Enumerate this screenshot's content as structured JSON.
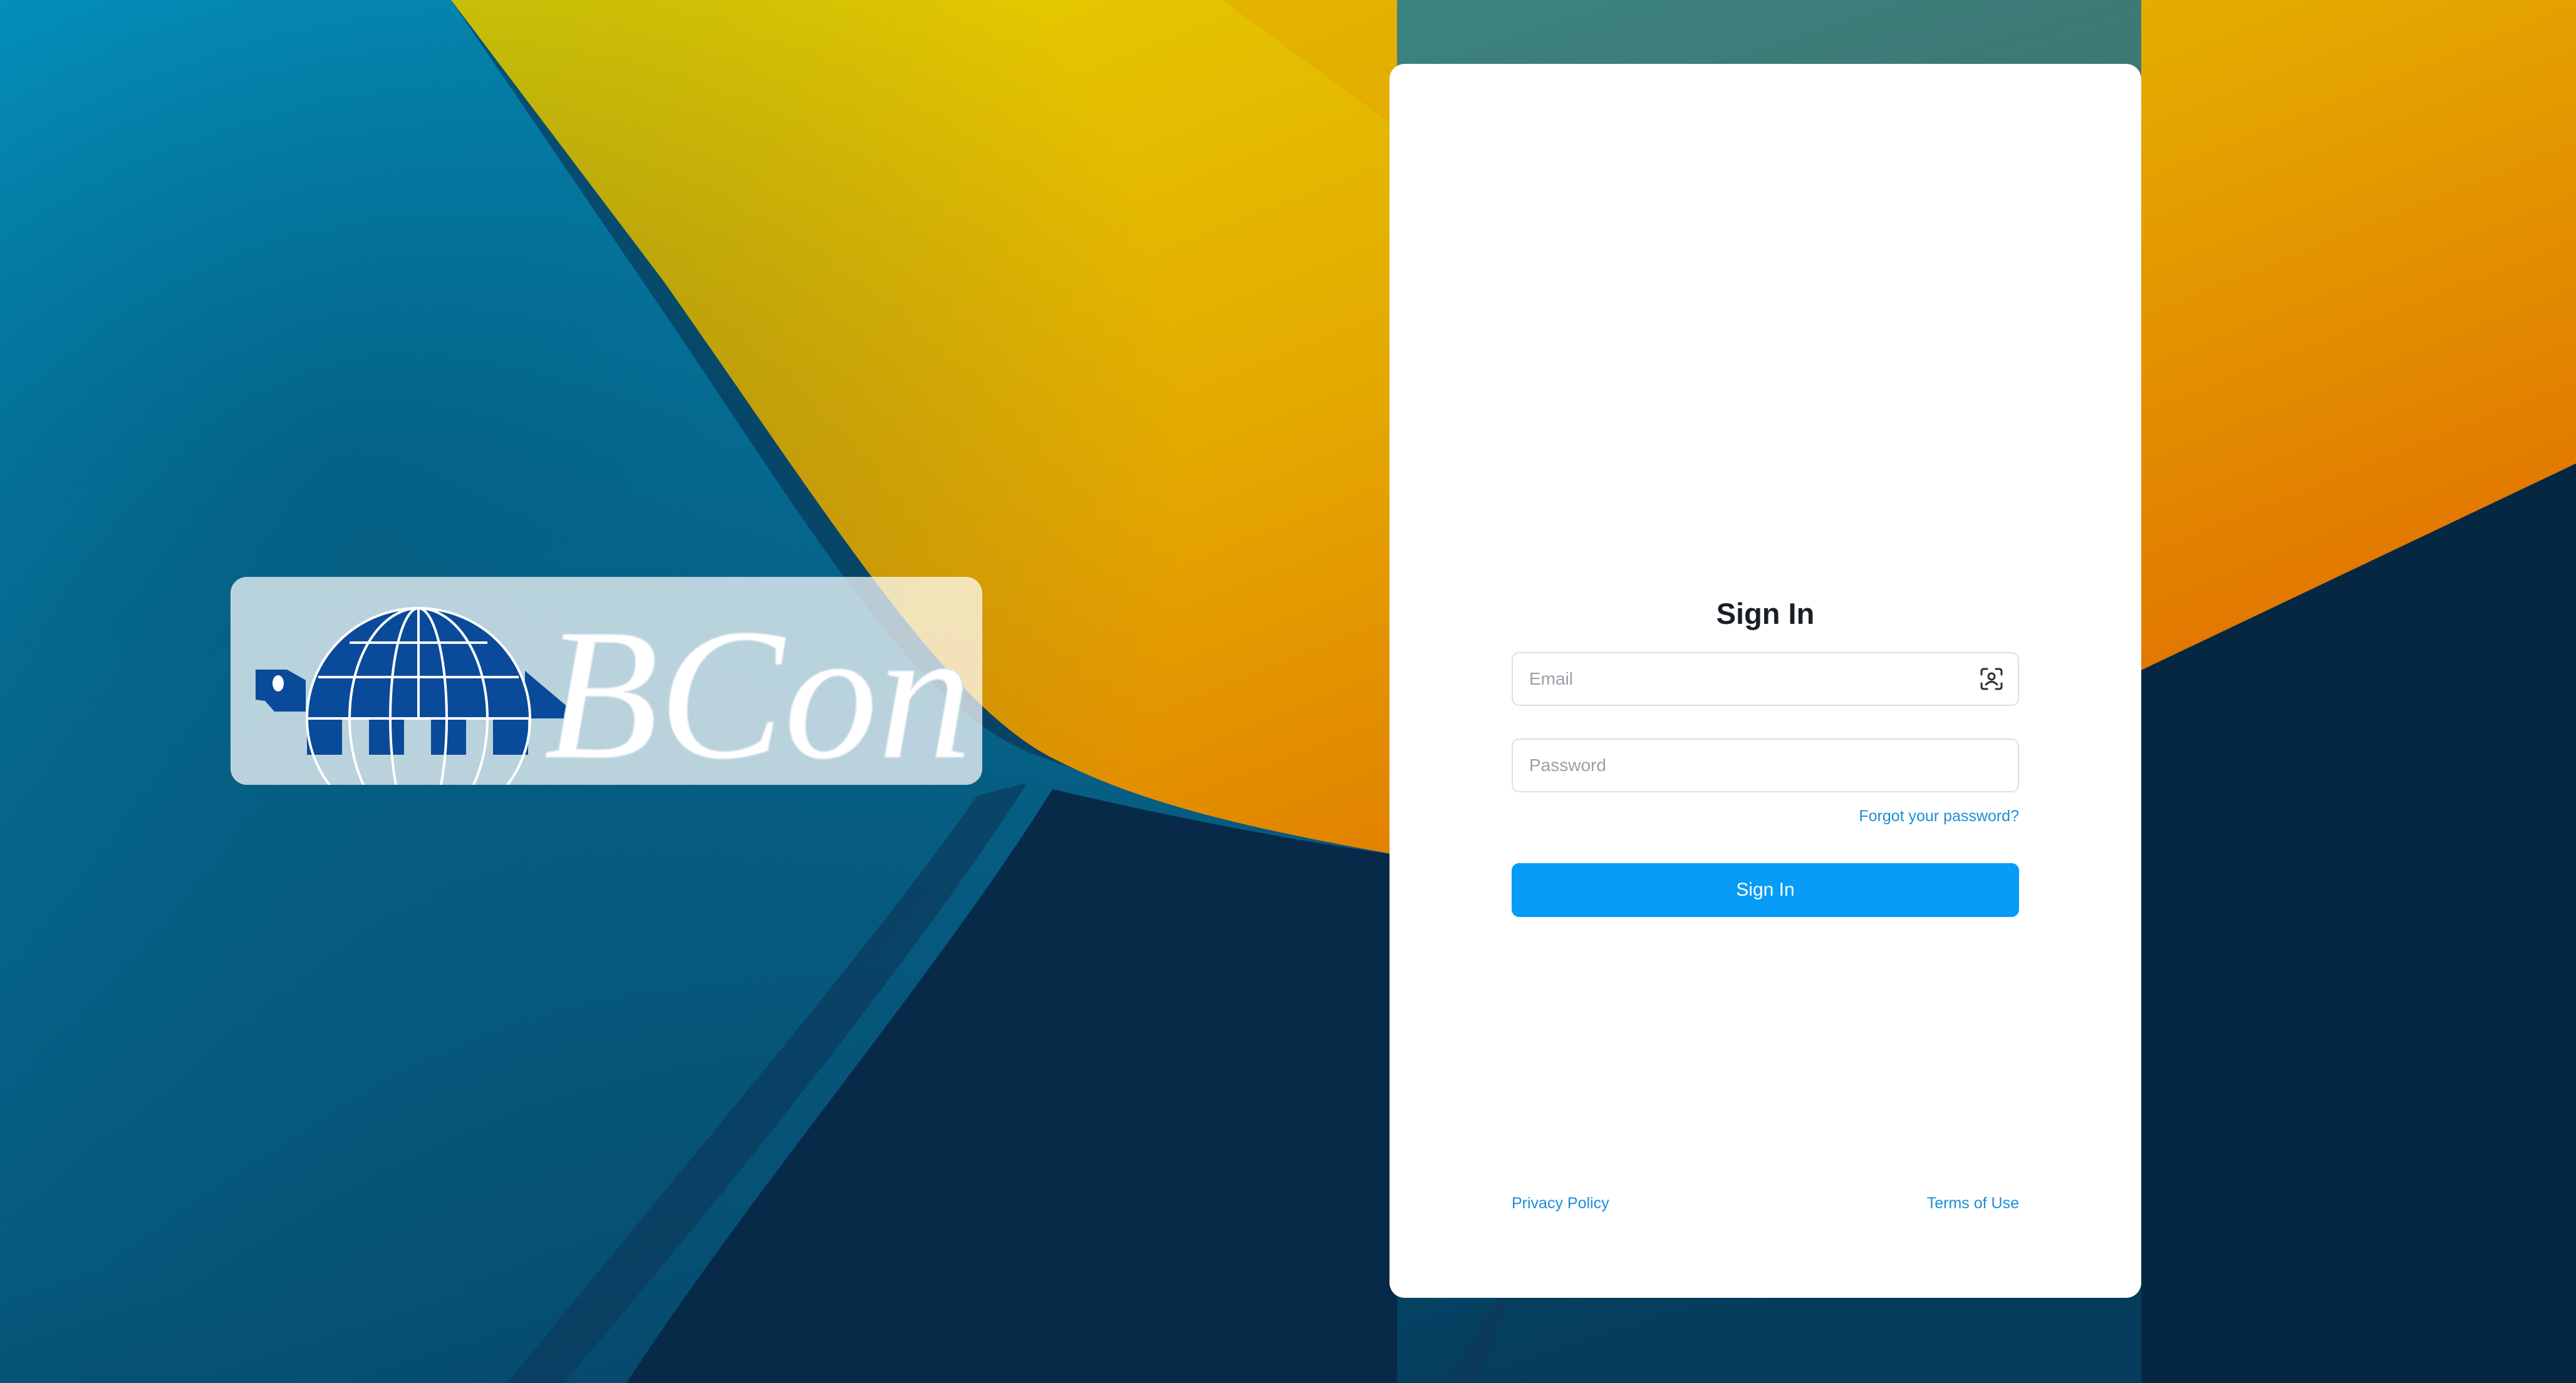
{
  "logo": {
    "text": "BCon"
  },
  "login": {
    "title": "Sign In",
    "email_placeholder": "Email",
    "password_placeholder": "Password",
    "forgot_password": "Forgot your password?",
    "submit_label": "Sign In",
    "face_id_icon": "face-id-icon"
  },
  "footer": {
    "privacy_policy": "Privacy Policy",
    "terms_of_use": "Terms of Use"
  },
  "colors": {
    "accent": "#079cf5",
    "link": "#1a8fd8",
    "logo_blue": "#0a4a9a",
    "bg_blue": "#0095c2",
    "bg_yellow": "#e3d400",
    "bg_orange": "#e26200",
    "bg_navy": "#062741"
  }
}
